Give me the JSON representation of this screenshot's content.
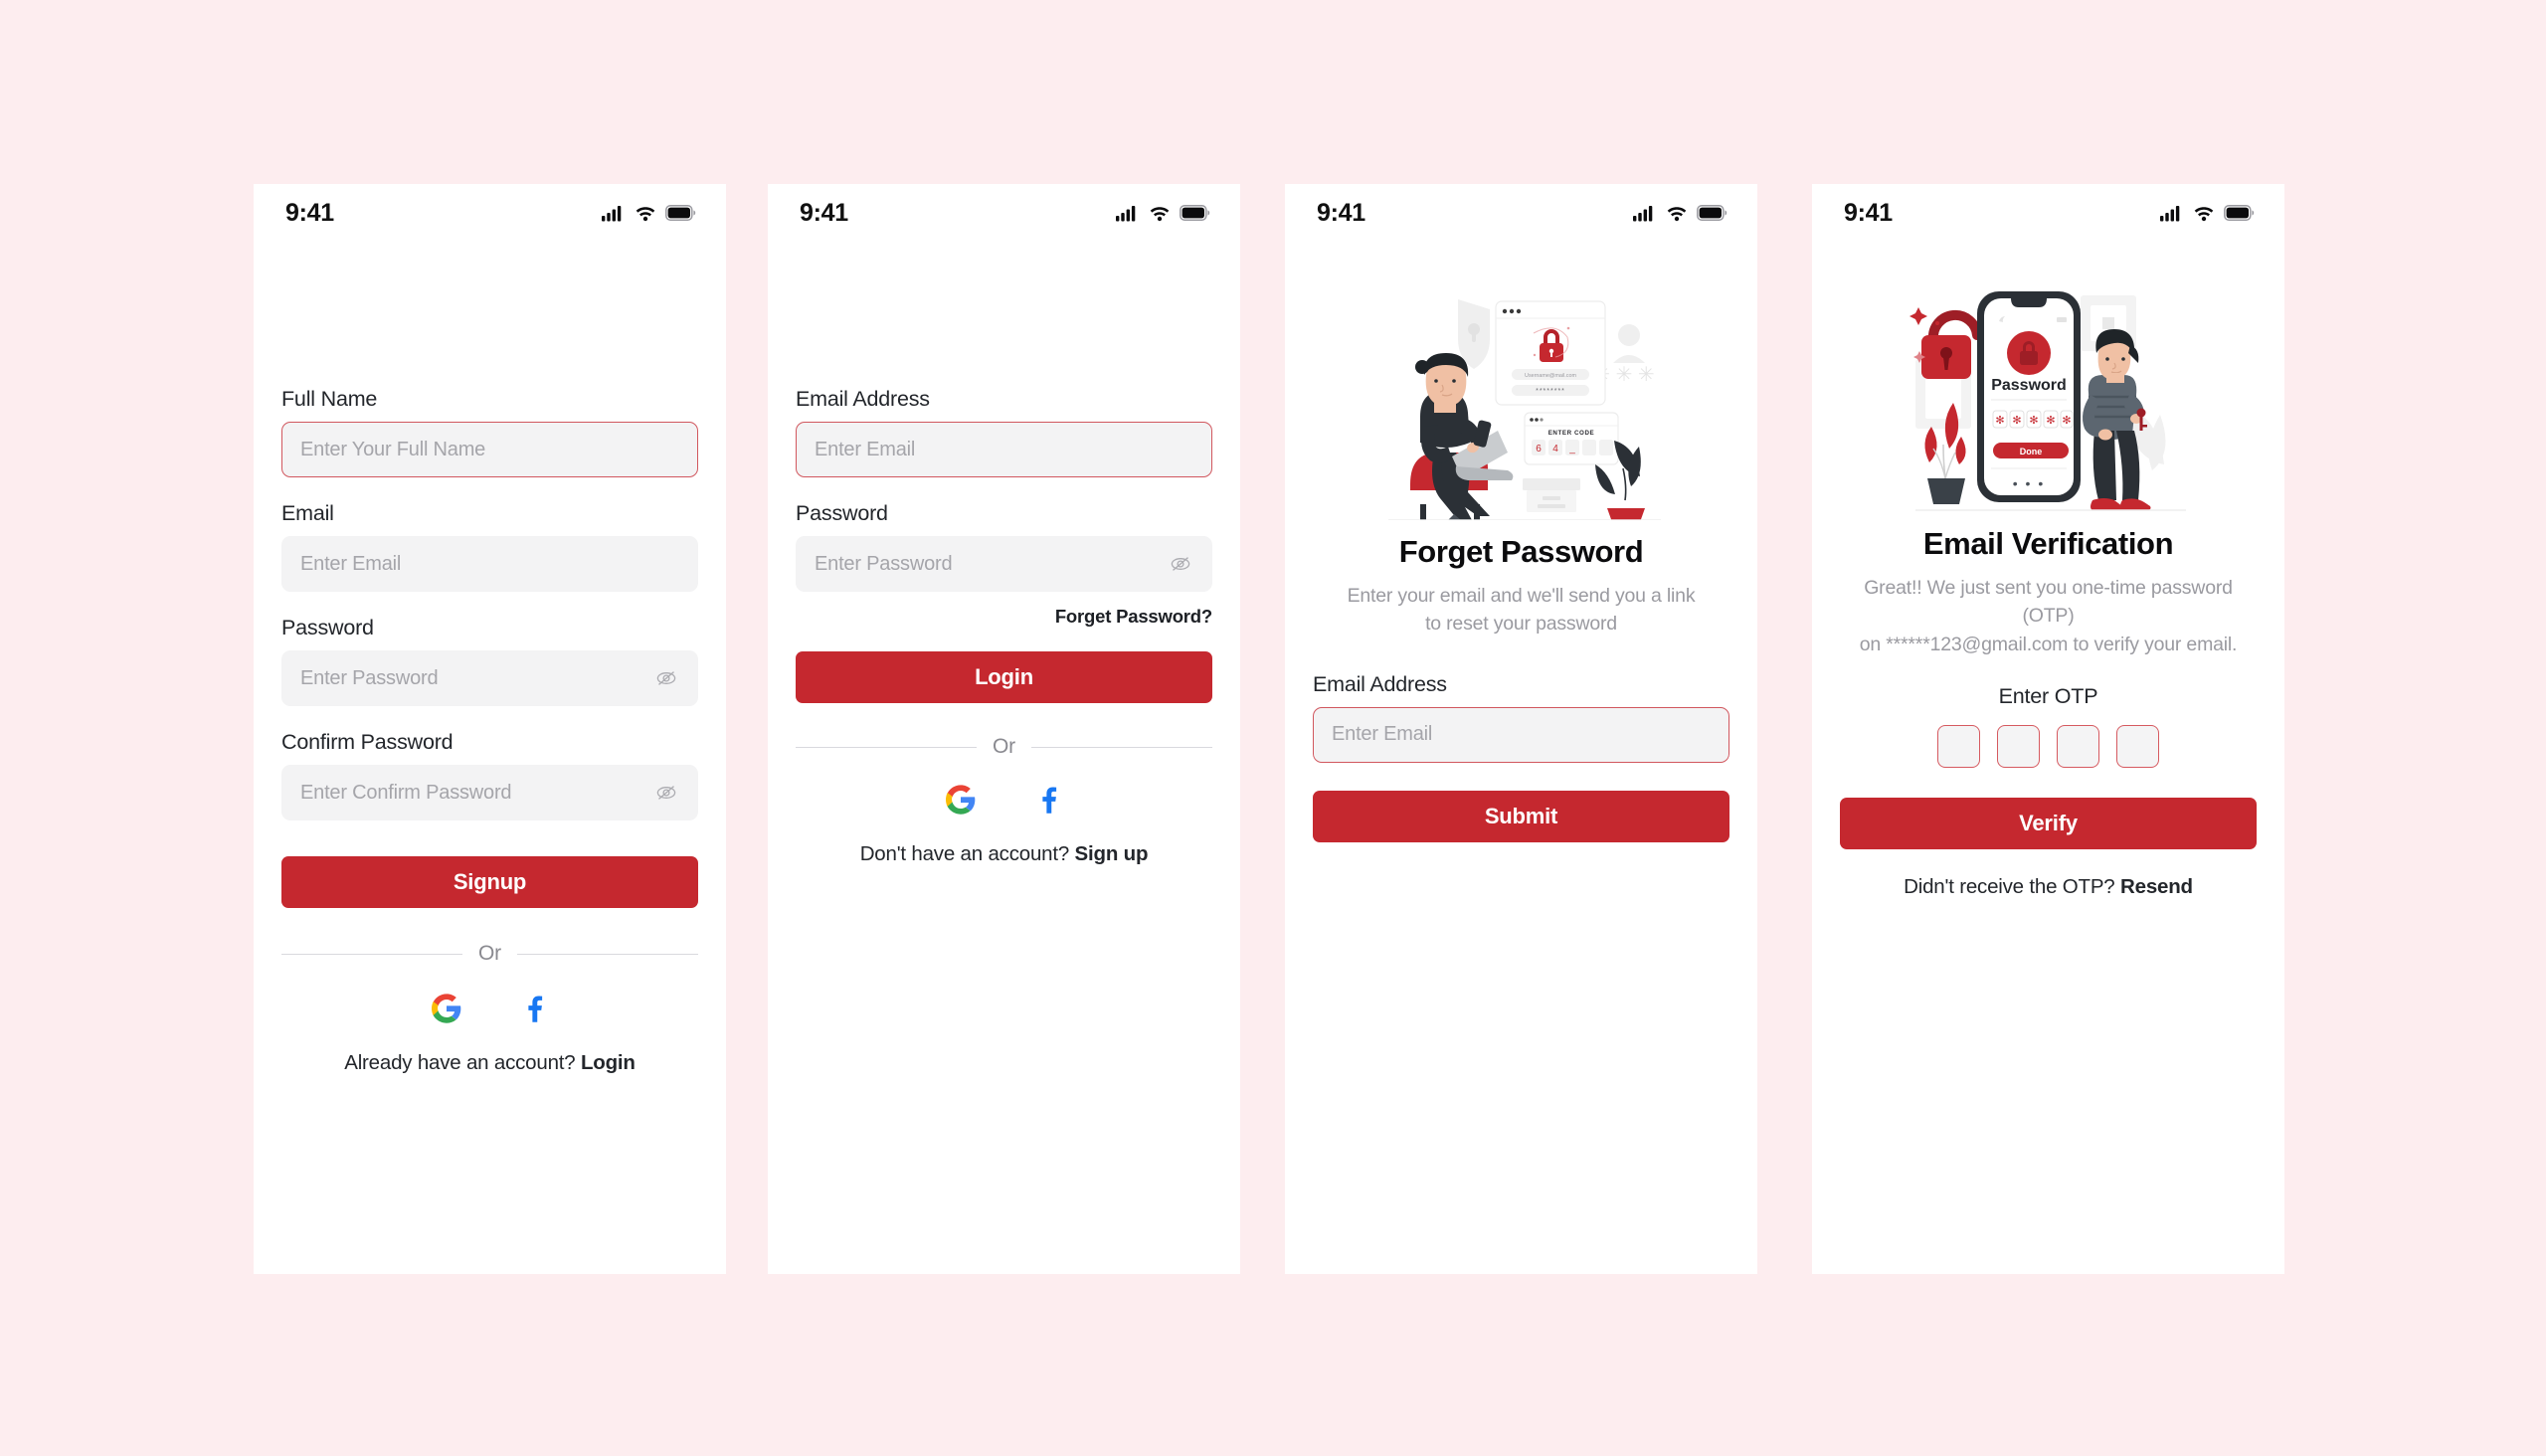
{
  "theme": {
    "page_background": "#FDEDEF",
    "card_background": "#FFFFFF",
    "accent_red": "#C5282F",
    "input_fill": "#F3F3F4",
    "input_border_active": "#D1575E",
    "placeholder_color": "#A5A5AA",
    "label_color": "#23262B",
    "muted_text": "#9A9AA0",
    "google_blue": "#4285F4",
    "google_red": "#EA4335",
    "google_yellow": "#FBBC05",
    "google_green": "#34A853",
    "facebook_blue": "#1877F2"
  },
  "status_bar": {
    "time": "9:41",
    "icons": [
      "cellular-signal-icon",
      "wifi-icon",
      "battery-icon"
    ]
  },
  "screens": [
    {
      "id": "signup",
      "name": "signup-screen",
      "fields": [
        {
          "label": "Full Name",
          "placeholder": "Enter Your Full Name",
          "focused": true,
          "has_eye": false
        },
        {
          "label": "Email",
          "placeholder": "Enter Email",
          "focused": false,
          "has_eye": false
        },
        {
          "label": "Password",
          "placeholder": "Enter Password",
          "focused": false,
          "has_eye": true
        },
        {
          "label": "Confirm Password",
          "placeholder": "Enter Confirm Password",
          "focused": false,
          "has_eye": true
        }
      ],
      "primary_button": "Signup",
      "divider_text": "Or",
      "social": [
        {
          "name": "google-signin-button",
          "icon": "google-icon"
        },
        {
          "name": "facebook-signin-button",
          "icon": "facebook-icon"
        }
      ],
      "footer_prefix": "Already have an account? ",
      "footer_link": "Login"
    },
    {
      "id": "login",
      "name": "login-screen",
      "fields": [
        {
          "label": "Email Address",
          "placeholder": "Enter  Email",
          "focused": true,
          "has_eye": false
        },
        {
          "label": "Password",
          "placeholder": "Enter Password",
          "focused": false,
          "has_eye": true
        }
      ],
      "forget_link": "Forget Password?",
      "primary_button": "Login",
      "divider_text": "Or",
      "social": [
        {
          "name": "google-signin-button",
          "icon": "google-icon"
        },
        {
          "name": "facebook-signin-button",
          "icon": "facebook-icon"
        }
      ],
      "footer_prefix": "Don't have an account? ",
      "footer_link": "Sign up"
    },
    {
      "id": "forgot",
      "name": "forget-password-screen",
      "illustration": "forgot-password-illustration",
      "title": "Forget Password",
      "subtitle_line1": "Enter your email and we'll send you a link",
      "subtitle_line2": "to reset your password",
      "fields": [
        {
          "label": "Email Address",
          "placeholder": "Enter  Email",
          "focused": true,
          "has_eye": false
        }
      ],
      "primary_button": "Submit"
    },
    {
      "id": "verify",
      "name": "email-verification-screen",
      "illustration": "email-verification-illustration",
      "title": "Email Verification",
      "subtitle_line1": "Great!! We just sent you one-time password (OTP)",
      "subtitle_line2": "on ******123@gmail.com to verify your email.",
      "otp_label": "Enter OTP",
      "otp_cells": [
        "",
        "",
        "",
        ""
      ],
      "primary_button": "Verify",
      "footer_prefix": "Didn't receive the OTP? ",
      "footer_link": "Resend"
    }
  ],
  "illustration_text": {
    "forgot": {
      "browser_email": "Username@mail.com",
      "browser_password": "********",
      "code_title": "ENTER CODE",
      "code_digits": [
        "6",
        "4",
        "-",
        "",
        ""
      ],
      "asterisks": "* * *"
    },
    "verify": {
      "phone_title": "Password",
      "phone_button": "Done",
      "phone_dots": "• • •"
    }
  }
}
